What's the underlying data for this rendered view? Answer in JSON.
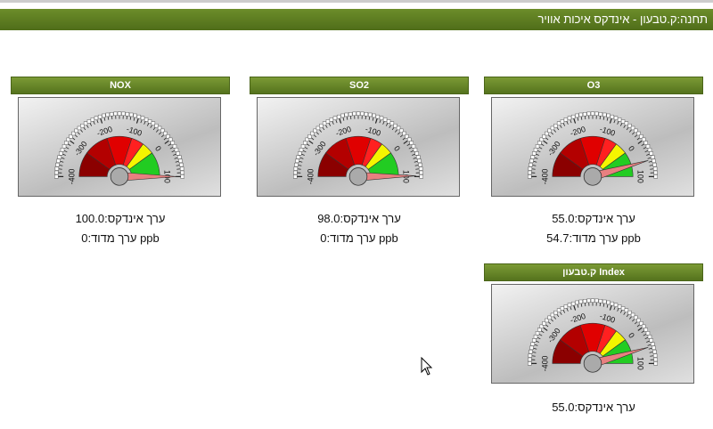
{
  "header": {
    "title": "תחנה:ק.טבעון - אינדקס איכות אוויר"
  },
  "gauge_ticks": [
    "-400",
    "-300",
    "-200",
    "-100",
    "0",
    "100"
  ],
  "panels": [
    {
      "title": "NOX",
      "index_text": "ערך אינדקס:100.0",
      "measured_text": "ערך מדוד:0 ppb",
      "index_value": 100.0
    },
    {
      "title": "SO2",
      "index_text": "ערך אינדקס:98.0",
      "measured_text": "ערך מדוד:0 ppb",
      "index_value": 98.0
    },
    {
      "title": "O3",
      "index_text": "ערך אינדקס:55.0",
      "measured_text": "ערך מדוד:54.7 ppb",
      "index_value": 55.0
    },
    {
      "title": "ק.טבעון Index",
      "index_text": "ערך אינדקס:55.0",
      "measured_text": "",
      "index_value": 55.0
    }
  ],
  "colors": {
    "header": "#5a7a20",
    "darkred": "#8b0000",
    "red": "#e00000",
    "yellow": "#f5f500",
    "green": "#22cc22",
    "needle": "#e88080"
  }
}
